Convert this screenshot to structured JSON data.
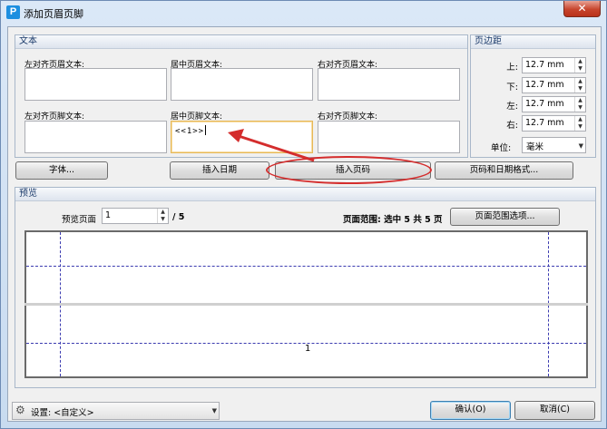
{
  "window": {
    "title": "添加页眉页脚",
    "close_label": "✕",
    "app_icon": "P"
  },
  "text_group": {
    "title": "文本",
    "header_left_label": "左对齐页眉文本:",
    "header_center_label": "居中页眉文本:",
    "header_right_label": "右对齐页眉文本:",
    "footer_left_label": "左对齐页脚文本:",
    "footer_center_label": "居中页脚文本:",
    "footer_right_label": "右对齐页脚文本:",
    "footer_center_value": "<<1>>"
  },
  "margin_group": {
    "title": "页边距",
    "top_label": "上:",
    "top_value": "12.7 mm",
    "bottom_label": "下:",
    "bottom_value": "12.7 mm",
    "left_label": "左:",
    "left_value": "12.7 mm",
    "right_label": "右:",
    "right_value": "12.7 mm",
    "unit_label": "单位:",
    "unit_value": "毫米"
  },
  "buttons": {
    "font": "字体...",
    "insert_date": "插入日期",
    "insert_page_number": "插入页码",
    "page_date_format": "页码和日期格式..."
  },
  "preview_group": {
    "title": "预览",
    "preview_page_label": "预览页面",
    "preview_page_value": "1",
    "total_pages": "/ 5",
    "page_range_text": "页面范围: 选中 5 共 5 页",
    "page_range_button": "页面范围选项...",
    "preview_page_number": "1"
  },
  "footer": {
    "settings_label": "设置: <自定义>",
    "ok": "确认(O)",
    "cancel": "取消(C)"
  },
  "colors": {
    "annotation_red": "#d42d2d",
    "guide_blue": "#3b3bb0"
  },
  "icons": {
    "settings": "gear-icon",
    "spin": "spin-arrows-icon"
  }
}
